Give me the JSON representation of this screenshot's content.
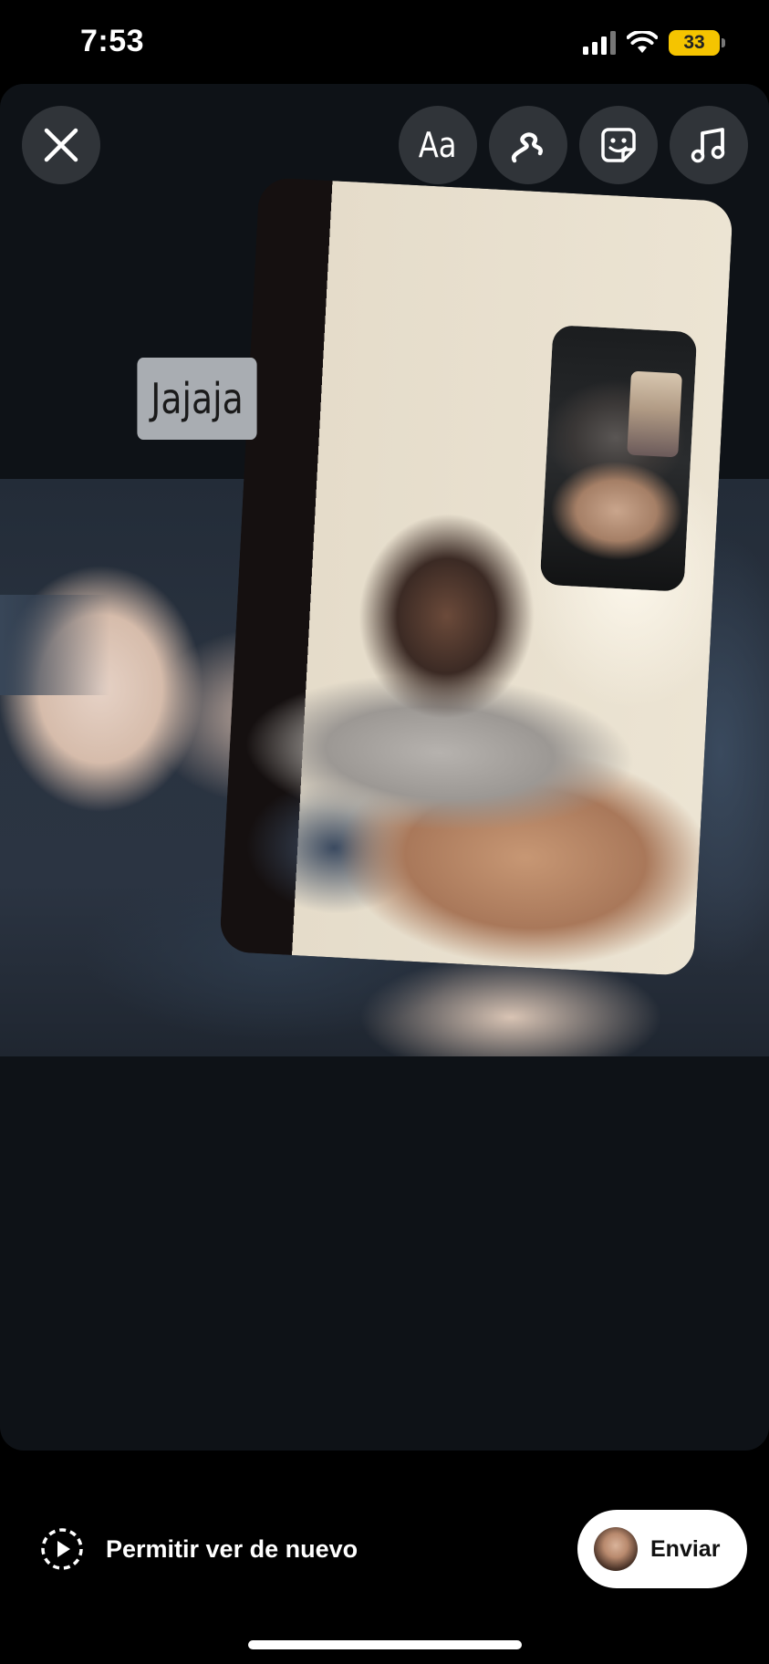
{
  "status_bar": {
    "time": "7:53",
    "battery": "33",
    "battery_color": "#f5c400"
  },
  "editor": {
    "toolbar": {
      "close_icon": "close-icon",
      "text_tool_label": "Aa",
      "draw_tool_icon": "scribble-icon",
      "sticker_tool_icon": "sticker-icon",
      "music_tool_icon": "music-note-icon"
    },
    "text_sticker": "Jajaja"
  },
  "footer": {
    "replay_icon": "replay-icon",
    "replay_label": "Permitir ver de nuevo",
    "send_label": "Enviar"
  },
  "colors": {
    "background": "#000000",
    "canvas": "#0e1217",
    "send_button": "#ffffff",
    "sticker_background": "#a9adb2"
  }
}
